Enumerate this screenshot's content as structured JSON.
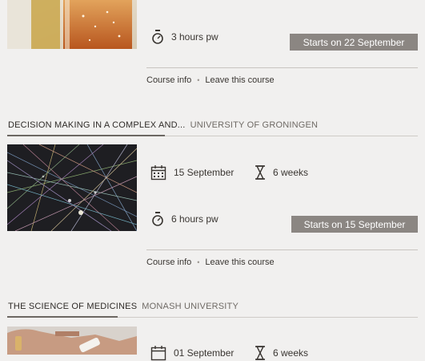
{
  "courses": [
    {
      "effort": "3 hours pw",
      "button": "Starts on 22 September",
      "links": {
        "info": "Course info",
        "leave": "Leave this course"
      }
    },
    {
      "name": "DECISION MAKING IN A COMPLEX AND...",
      "university": "UNIVERSITY OF GRONINGEN",
      "start_date": "15 September",
      "duration": "6 weeks",
      "effort": "6 hours pw",
      "button": "Starts on 15 September",
      "links": {
        "info": "Course info",
        "leave": "Leave this course"
      }
    },
    {
      "name": "THE SCIENCE OF MEDICINES",
      "university": "MONASH UNIVERSITY",
      "start_date": "01 September",
      "duration": "6 weeks"
    }
  ],
  "link_separator": "•",
  "colors": {
    "background": "#f1f0ef",
    "button": "#8b8682",
    "button_text": "#ffffff"
  }
}
